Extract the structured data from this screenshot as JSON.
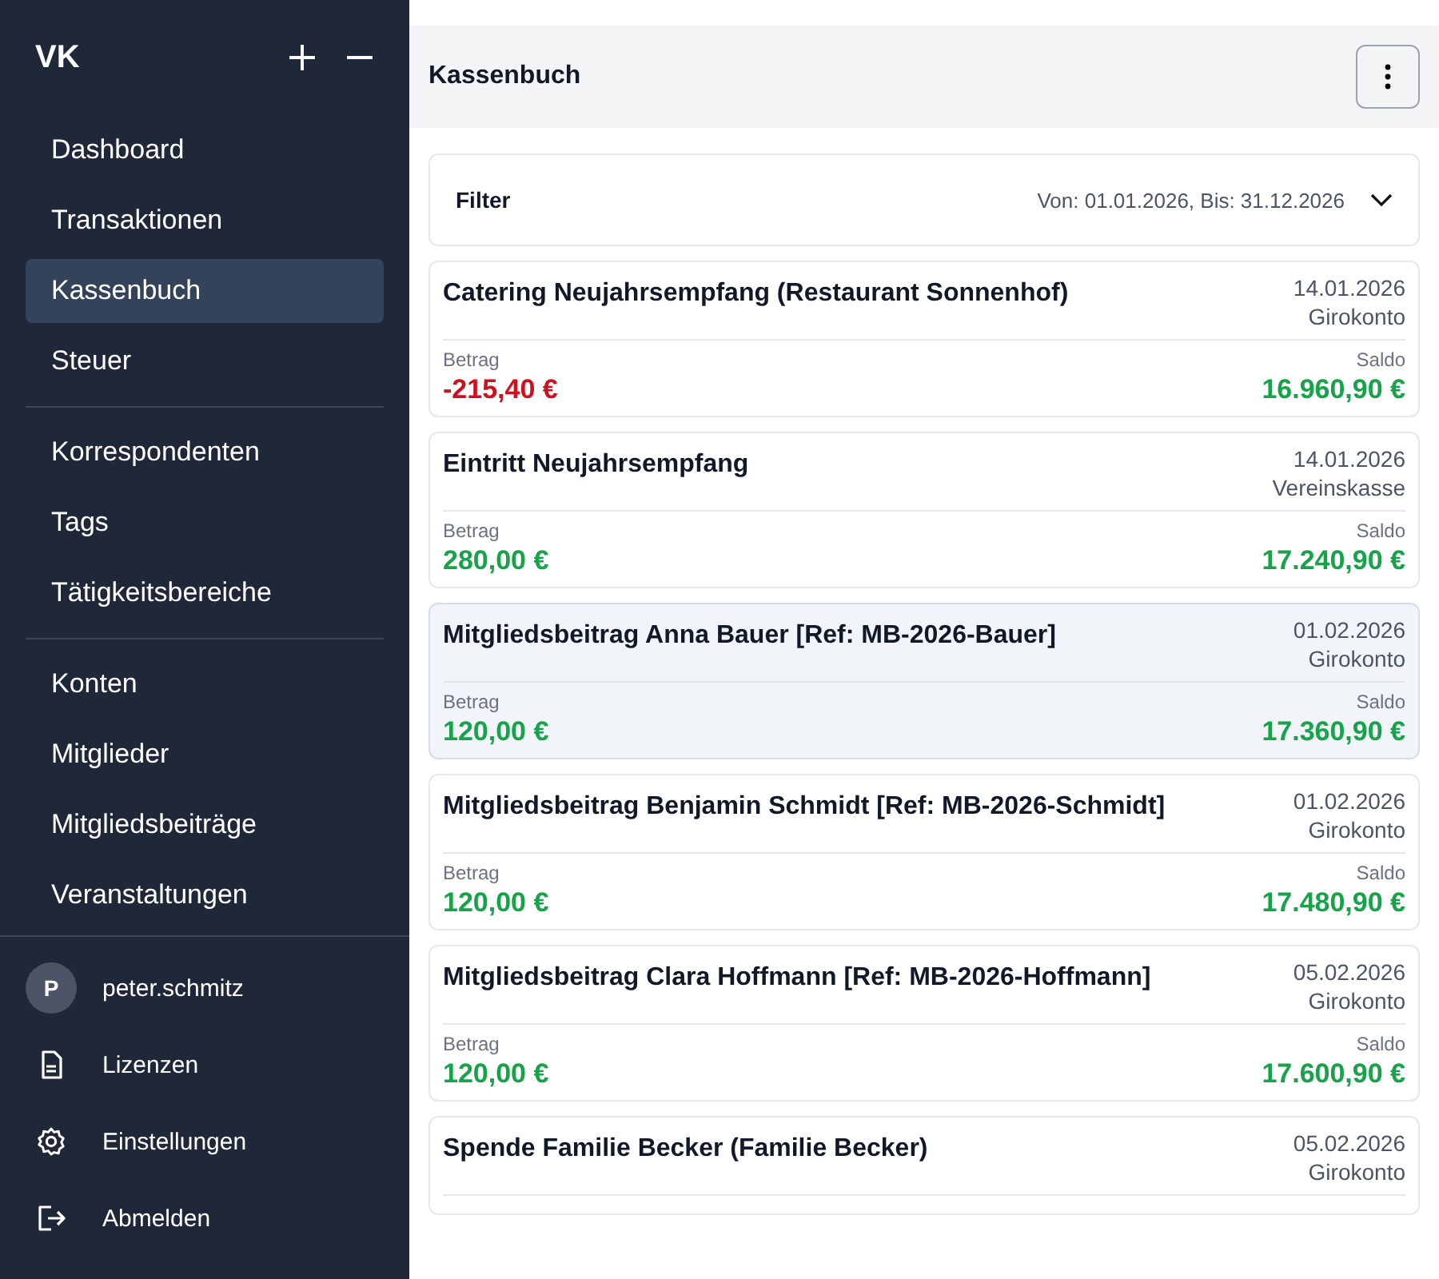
{
  "sidebar": {
    "logo": "VK",
    "sections": [
      [
        {
          "label": "Dashboard",
          "selected": false
        },
        {
          "label": "Transaktionen",
          "selected": false
        },
        {
          "label": "Kassenbuch",
          "selected": true
        },
        {
          "label": "Steuer",
          "selected": false
        }
      ],
      [
        {
          "label": "Korrespondenten",
          "selected": false
        },
        {
          "label": "Tags",
          "selected": false
        },
        {
          "label": "Tätigkeitsbereiche",
          "selected": false
        }
      ],
      [
        {
          "label": "Konten",
          "selected": false
        },
        {
          "label": "Mitglieder",
          "selected": false
        },
        {
          "label": "Mitgliedsbeiträge",
          "selected": false
        },
        {
          "label": "Veranstaltungen",
          "selected": false
        }
      ]
    ],
    "user": {
      "initial": "P",
      "name": "peter.schmitz"
    },
    "footer_items": [
      {
        "label": "Lizenzen",
        "kind": "document"
      },
      {
        "label": "Einstellungen",
        "kind": "settings"
      },
      {
        "label": "Abmelden",
        "kind": "logout"
      }
    ]
  },
  "header": {
    "title": "Kassenbuch"
  },
  "filter": {
    "label": "Filter",
    "range": "Von: 01.01.2026, Bis: 31.12.2026",
    "expanded": false
  },
  "entries": [
    {
      "title": "Catering Neujahrsempfang (Restaurant Sonnenhof)",
      "date": "14.01.2026",
      "account": "Girokonto",
      "amount_label": "Betrag",
      "amount": "-215,40 €",
      "kind": "expense",
      "balance_label": "Saldo",
      "balance": "16.960,90 €",
      "highlighted": false
    },
    {
      "title": "Eintritt Neujahrsempfang",
      "date": "14.01.2026",
      "account": "Vereinskasse",
      "amount_label": "Betrag",
      "amount": "280,00 €",
      "kind": "income",
      "balance_label": "Saldo",
      "balance": "17.240,90 €",
      "highlighted": false
    },
    {
      "title": "Mitgliedsbeitrag Anna Bauer [Ref: MB-2026-Bauer]",
      "date": "01.02.2026",
      "account": "Girokonto",
      "amount_label": "Betrag",
      "amount": "120,00 €",
      "kind": "income",
      "balance_label": "Saldo",
      "balance": "17.360,90 €",
      "highlighted": true
    },
    {
      "title": "Mitgliedsbeitrag Benjamin Schmidt [Ref: MB-2026-Schmidt]",
      "date": "01.02.2026",
      "account": "Girokonto",
      "amount_label": "Betrag",
      "amount": "120,00 €",
      "kind": "income",
      "balance_label": "Saldo",
      "balance": "17.480,90 €",
      "highlighted": false
    },
    {
      "title": "Mitgliedsbeitrag Clara Hoffmann [Ref: MB-2026-Hoffmann]",
      "date": "05.02.2026",
      "account": "Girokonto",
      "amount_label": "Betrag",
      "amount": "120,00 €",
      "kind": "income",
      "balance_label": "Saldo",
      "balance": "17.600,90 €",
      "highlighted": false
    },
    {
      "title": "Spende Familie Becker (Familie Becker)",
      "date": "05.02.2026",
      "account": "Girokonto",
      "highlighted": false
    }
  ]
}
